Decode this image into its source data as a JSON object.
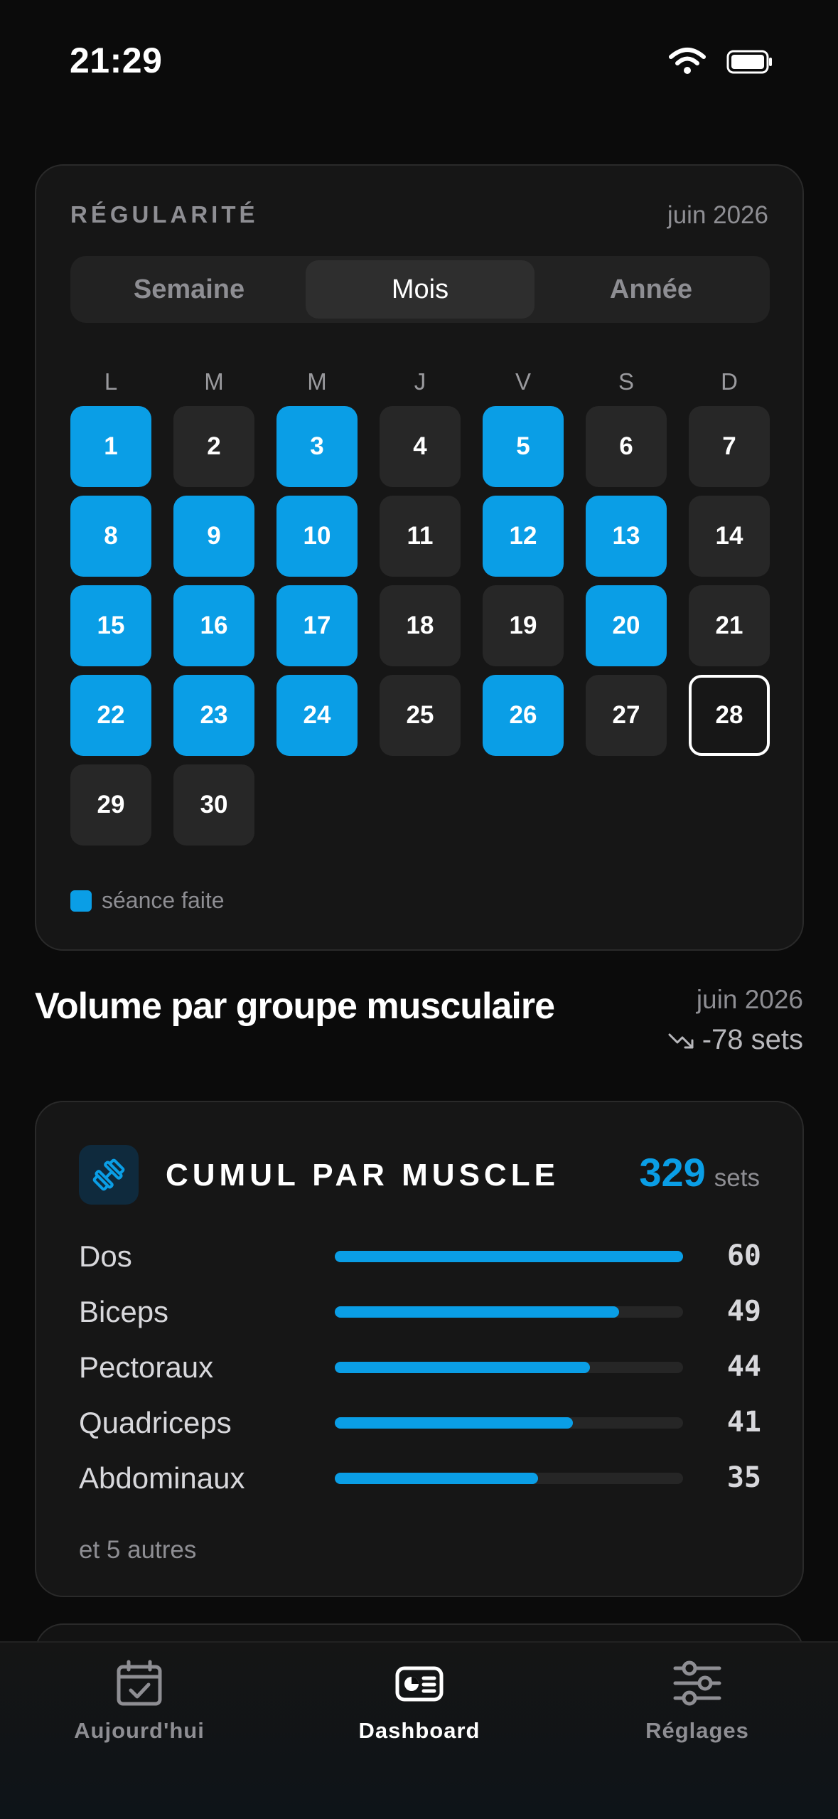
{
  "status": {
    "time": "21:29"
  },
  "regularity": {
    "label": "RÉGULARITÉ",
    "month": "juin 2026",
    "segments": [
      "Semaine",
      "Mois",
      "Année"
    ],
    "active_segment": "Mois",
    "weekdays": [
      "L",
      "M",
      "M",
      "J",
      "V",
      "S",
      "D"
    ],
    "days": [
      {
        "n": "1",
        "done": true
      },
      {
        "n": "2",
        "done": false
      },
      {
        "n": "3",
        "done": true
      },
      {
        "n": "4",
        "done": false
      },
      {
        "n": "5",
        "done": true
      },
      {
        "n": "6",
        "done": false
      },
      {
        "n": "7",
        "done": false
      },
      {
        "n": "8",
        "done": true
      },
      {
        "n": "9",
        "done": true
      },
      {
        "n": "10",
        "done": true
      },
      {
        "n": "11",
        "done": false
      },
      {
        "n": "12",
        "done": true
      },
      {
        "n": "13",
        "done": true
      },
      {
        "n": "14",
        "done": false
      },
      {
        "n": "15",
        "done": true
      },
      {
        "n": "16",
        "done": true
      },
      {
        "n": "17",
        "done": true
      },
      {
        "n": "18",
        "done": false
      },
      {
        "n": "19",
        "done": false
      },
      {
        "n": "20",
        "done": true
      },
      {
        "n": "21",
        "done": false
      },
      {
        "n": "22",
        "done": true
      },
      {
        "n": "23",
        "done": true
      },
      {
        "n": "24",
        "done": true
      },
      {
        "n": "25",
        "done": false
      },
      {
        "n": "26",
        "done": true
      },
      {
        "n": "27",
        "done": false
      },
      {
        "n": "28",
        "done": false,
        "today": true
      },
      {
        "n": "29",
        "done": false
      },
      {
        "n": "30",
        "done": false
      }
    ],
    "legend": "séance faite",
    "colors": {
      "done": "#0a9ee6"
    }
  },
  "volume": {
    "title": "Volume par groupe musculaire",
    "month": "juin 2026",
    "delta": "-78 sets"
  },
  "cumul": {
    "title": "CUMUL PAR MUSCLE",
    "total": "329",
    "unit": "sets",
    "max": 60,
    "muscles": [
      {
        "name": "Dos",
        "value": 60
      },
      {
        "name": "Biceps",
        "value": 49
      },
      {
        "name": "Pectoraux",
        "value": 44
      },
      {
        "name": "Quadriceps",
        "value": 41
      },
      {
        "name": "Abdominaux",
        "value": 35
      }
    ],
    "more": "et 5 autres"
  },
  "tabs": [
    {
      "label": "Aujourd'hui",
      "icon": "calendar-check-icon",
      "active": false
    },
    {
      "label": "Dashboard",
      "icon": "dashboard-icon",
      "active": true
    },
    {
      "label": "Réglages",
      "icon": "sliders-icon",
      "active": false
    }
  ]
}
